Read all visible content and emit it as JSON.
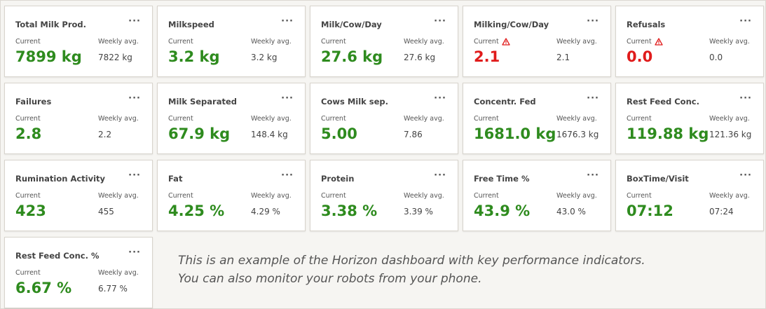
{
  "labels": {
    "current": "Current",
    "weekly": "Weekly avg.",
    "menu": "···"
  },
  "colors": {
    "good": "#2e8b1e",
    "alert": "#e01b1b"
  },
  "cards": [
    {
      "title": "Total Milk Prod.",
      "current": "7899 kg",
      "weekly": "7822 kg",
      "alert": false
    },
    {
      "title": "Milkspeed",
      "current": "3.2 kg",
      "weekly": "3.2 kg",
      "alert": false
    },
    {
      "title": "Milk/Cow/Day",
      "current": "27.6 kg",
      "weekly": "27.6 kg",
      "alert": false
    },
    {
      "title": "Milking/Cow/Day",
      "current": "2.1",
      "weekly": "2.1",
      "alert": true
    },
    {
      "title": "Refusals",
      "current": "0.0",
      "weekly": "0.0",
      "alert": true
    },
    {
      "title": "Failures",
      "current": "2.8",
      "weekly": "2.2",
      "alert": false
    },
    {
      "title": "Milk Separated",
      "current": "67.9 kg",
      "weekly": "148.4 kg",
      "alert": false
    },
    {
      "title": "Cows Milk sep.",
      "current": "5.00",
      "weekly": "7.86",
      "alert": false
    },
    {
      "title": "Concentr. Fed",
      "current": "1681.0 kg",
      "weekly": "1676.3 kg",
      "alert": false
    },
    {
      "title": "Rest Feed Conc.",
      "current": "119.88 kg",
      "weekly": "121.36 kg",
      "alert": false
    },
    {
      "title": "Rumination Activity",
      "current": "423",
      "weekly": "455",
      "alert": false
    },
    {
      "title": "Fat",
      "current": "4.25 %",
      "weekly": "4.29 %",
      "alert": false
    },
    {
      "title": "Protein",
      "current": "3.38 %",
      "weekly": "3.39 %",
      "alert": false
    },
    {
      "title": "Free Time %",
      "current": "43.9 %",
      "weekly": "43.0 %",
      "alert": false
    },
    {
      "title": "BoxTime/Visit",
      "current": "07:12",
      "weekly": "07:24",
      "alert": false
    },
    {
      "title": "Rest Feed Conc. %",
      "current": "6.67 %",
      "weekly": "6.77 %",
      "alert": false
    }
  ],
  "caption": {
    "line1": "This is an example of the Horizon dashboard with key performance indicators.",
    "line2": "You can also monitor your robots from your phone."
  }
}
